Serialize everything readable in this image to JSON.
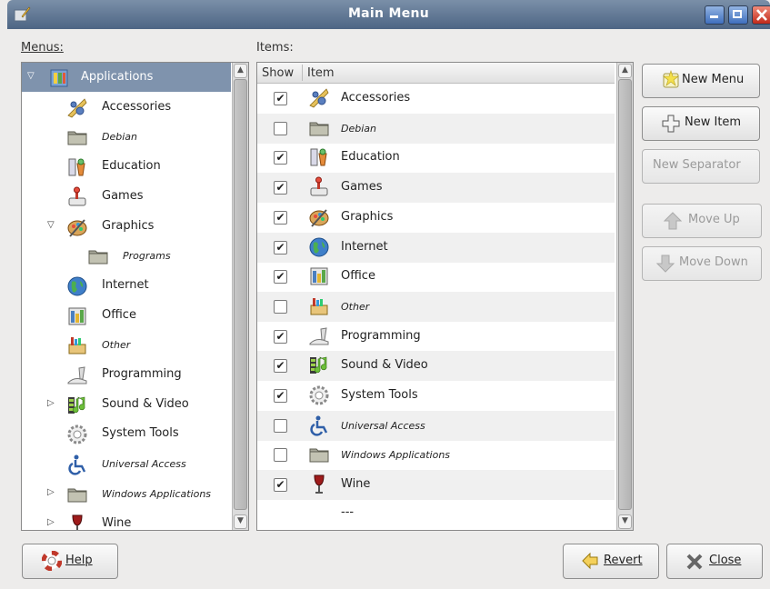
{
  "window": {
    "title": "Main Menu",
    "controls": [
      "minimize",
      "maximize",
      "close"
    ]
  },
  "labels": {
    "menus": "Menus:",
    "items": "Items:"
  },
  "menus_tree": [
    {
      "label": "Applications",
      "italic": false,
      "expanded": true,
      "selected": true,
      "icon": "applications-icon"
    },
    {
      "label": "Accessories",
      "italic": false,
      "icon": "accessories-icon"
    },
    {
      "label": "Debian",
      "italic": true,
      "icon": "folder-icon"
    },
    {
      "label": "Education",
      "italic": false,
      "icon": "education-icon"
    },
    {
      "label": "Games",
      "italic": false,
      "icon": "games-icon"
    },
    {
      "label": "Graphics",
      "italic": false,
      "expanded": true,
      "icon": "graphics-icon"
    },
    {
      "label": "Programs",
      "italic": true,
      "icon": "folder-icon"
    },
    {
      "label": "Internet",
      "italic": false,
      "icon": "globe-icon"
    },
    {
      "label": "Office",
      "italic": false,
      "icon": "office-icon"
    },
    {
      "label": "Other",
      "italic": true,
      "icon": "other-icon"
    },
    {
      "label": "Programming",
      "italic": false,
      "icon": "programming-icon"
    },
    {
      "label": "Sound & Video",
      "italic": false,
      "collapsed": true,
      "icon": "sound-video-icon"
    },
    {
      "label": "System Tools",
      "italic": false,
      "icon": "gear-icon"
    },
    {
      "label": "Universal Access",
      "italic": true,
      "icon": "accessibility-icon"
    },
    {
      "label": "Windows Applications",
      "italic": true,
      "collapsed": true,
      "icon": "folder-icon"
    },
    {
      "label": "Wine",
      "italic": false,
      "collapsed": true,
      "icon": "wine-icon"
    }
  ],
  "items_table": {
    "columns": [
      "Show",
      "Item"
    ],
    "rows": [
      {
        "checked": true,
        "label": "Accessories",
        "italic": false,
        "icon": "accessories-icon"
      },
      {
        "checked": false,
        "label": "Debian",
        "italic": true,
        "icon": "folder-icon"
      },
      {
        "checked": true,
        "label": "Education",
        "italic": false,
        "icon": "education-icon"
      },
      {
        "checked": true,
        "label": "Games",
        "italic": false,
        "icon": "games-icon"
      },
      {
        "checked": true,
        "label": "Graphics",
        "italic": false,
        "icon": "graphics-icon"
      },
      {
        "checked": true,
        "label": "Internet",
        "italic": false,
        "icon": "globe-icon"
      },
      {
        "checked": true,
        "label": "Office",
        "italic": false,
        "icon": "office-icon"
      },
      {
        "checked": false,
        "label": "Other",
        "italic": true,
        "icon": "other-icon"
      },
      {
        "checked": true,
        "label": "Programming",
        "italic": false,
        "icon": "programming-icon"
      },
      {
        "checked": true,
        "label": "Sound & Video",
        "italic": false,
        "icon": "sound-video-icon"
      },
      {
        "checked": true,
        "label": "System Tools",
        "italic": false,
        "icon": "gear-icon"
      },
      {
        "checked": false,
        "label": "Universal Access",
        "italic": true,
        "icon": "accessibility-icon"
      },
      {
        "checked": false,
        "label": "Windows Applications",
        "italic": true,
        "icon": "folder-icon"
      },
      {
        "checked": true,
        "label": "Wine",
        "italic": false,
        "icon": "wine-icon"
      },
      {
        "separator": true,
        "label": "---"
      }
    ]
  },
  "buttons": {
    "new_menu": "New Menu",
    "new_item": "New Item",
    "new_separator": "New Separator",
    "move_up": "Move Up",
    "move_down": "Move Down",
    "help": "Help",
    "revert": "Revert",
    "close": "Close"
  },
  "colors": {
    "titlebar": "#4d6584",
    "selection": "#7f93ad",
    "disabled_text": "#9a9a9a"
  }
}
